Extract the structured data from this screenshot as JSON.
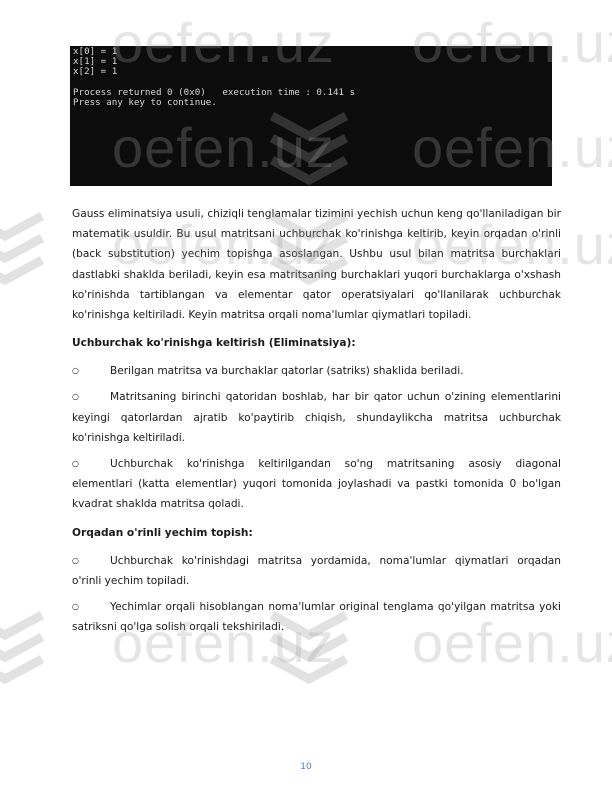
{
  "console": {
    "lines": [
      "x[0] = 1",
      "x[1] = 1",
      "x[2] = 1",
      "",
      "Process returned 0 (0x0)   execution time : 0.141 s",
      "Press any key to continue."
    ]
  },
  "watermark": {
    "text": "oefen.uz"
  },
  "intro_paragraph": "Gauss eliminatsiya usuli, chiziqli tenglamalar tizimini yechish uchun keng qo'llaniladigan bir matematik usuldir. Bu usul matritsani uchburchak ko'rinishga keltirib, keyin orqadan o'rinli (back substitution) yechim topishga asoslangan. Ushbu usul bilan matritsa burchaklari dastlabki shaklda beriladi, keyin esa matritsaning burchaklari yuqori burchaklarga o'xshash ko'rinishda tartiblangan va elementar qator operatsiyalari qo'llanilarak uchburchak ko'rinishga keltiriladi. Keyin matritsa orqali noma'lumlar qiymatlari topiladi.",
  "section1": {
    "heading": "Uchburchak ko'rinishga keltirish (Eliminatsiya):",
    "items": [
      "Berilgan matritsa va burchaklar qatorlar (satriks) shaklida beriladi.",
      "Matritsaning birinchi qatoridan boshlab, har bir qator uchun o'zining elementlarini keyingi qatorlardan ajratib ko'paytirib chiqish, shundaylikcha matritsa uchburchak ko'rinishga keltiriladi.",
      "Uchburchak ko'rinishga keltirilgandan so'ng matritsaning asosiy diagonal elementlari (katta elementlar) yuqori tomonida joylashadi va pastki tomonida 0 bo'lgan kvadrat shaklda matritsa qoladi."
    ]
  },
  "section2": {
    "heading": "Orqadan o'rinli yechim topish:",
    "items": [
      "Uchburchak ko'rinishdagi matritsa yordamida, noma'lumlar qiymatlari orqadan o'rinli yechim topiladi.",
      "Yechimlar orqali hisoblangan noma'lumlar original tenglama qo'yilgan matritsa yoki satriksni qo'lga solish orqali tekshiriladi."
    ]
  },
  "bullet_symbol": "○",
  "page_number": "10"
}
